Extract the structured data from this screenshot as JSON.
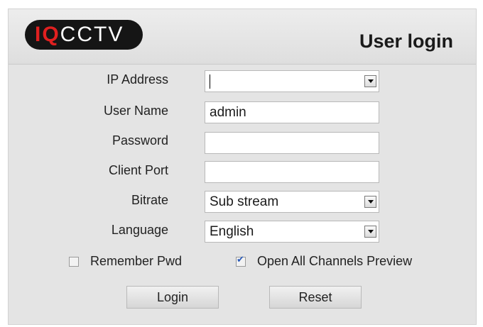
{
  "brand": {
    "prefix": "IQ",
    "suffix": "CCTV"
  },
  "title": "User login",
  "fields": [
    {
      "label": "IP Address",
      "value": "",
      "type": "combo"
    },
    {
      "label": "User Name",
      "value": "admin",
      "type": "text"
    },
    {
      "label": "Password",
      "value": "",
      "type": "password"
    },
    {
      "label": "Client Port",
      "value": "",
      "type": "text"
    },
    {
      "label": "Bitrate",
      "value": "Sub stream",
      "type": "select"
    },
    {
      "label": "Language",
      "value": "English",
      "type": "select"
    }
  ],
  "options": {
    "remember_pwd": {
      "label": "Remember Pwd",
      "checked": false
    },
    "open_all_channels": {
      "label": "Open All Channels Preview",
      "checked": true
    }
  },
  "buttons": {
    "login": "Login",
    "reset": "Reset"
  },
  "colors": {
    "logo_bg": "#151515",
    "logo_accent": "#e02020",
    "dialog_bg": "#e4e4e4",
    "check_mark": "#2a5ab8"
  }
}
